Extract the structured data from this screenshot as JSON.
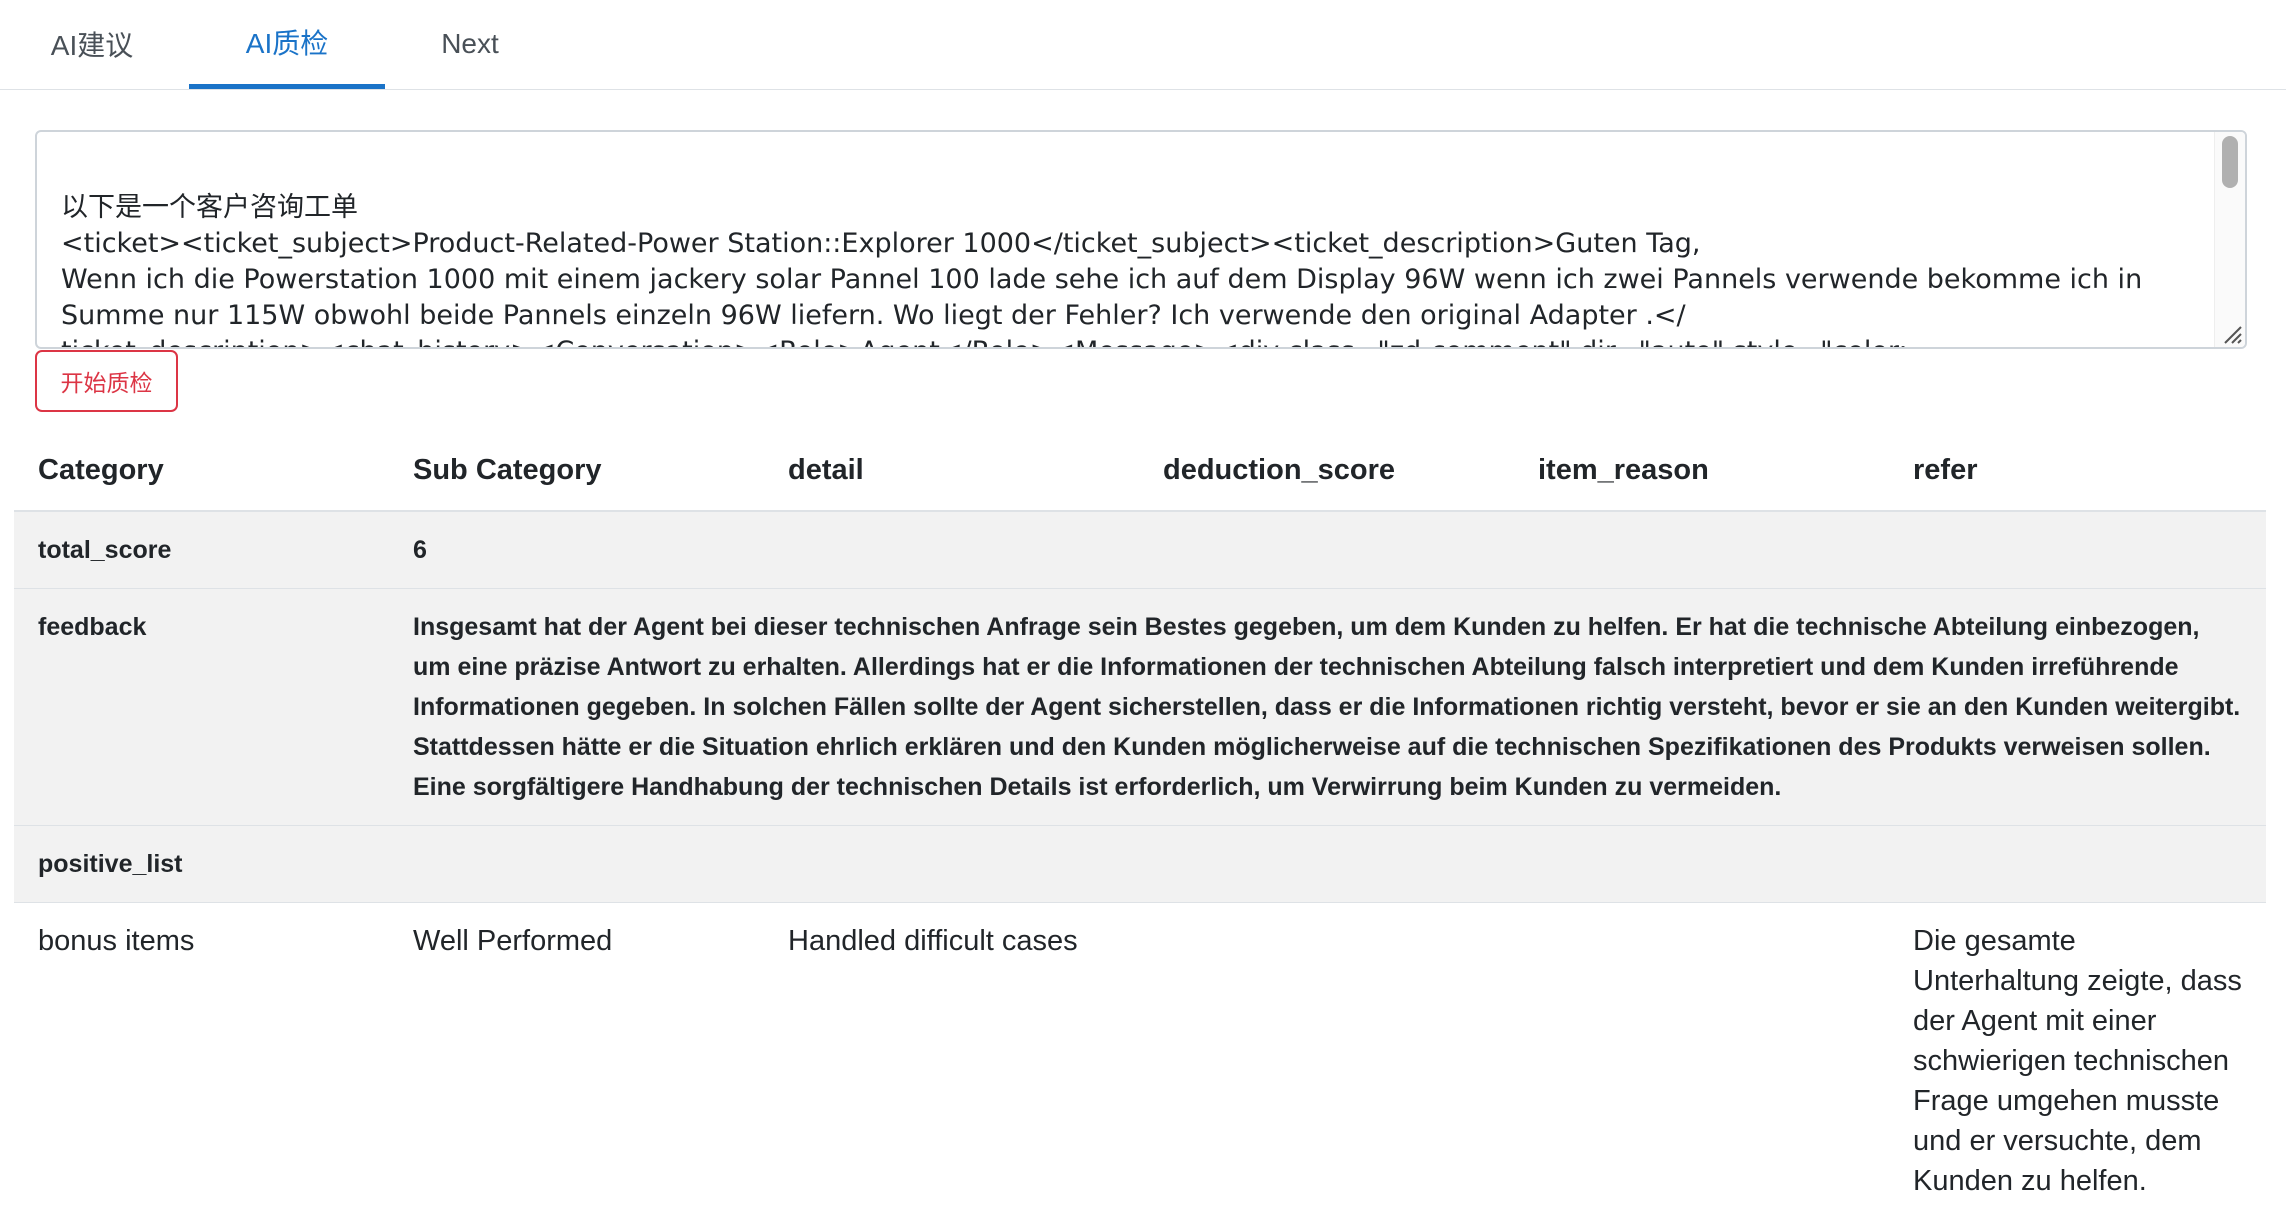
{
  "tabs": [
    {
      "label": "AI建议",
      "active": false
    },
    {
      "label": "AI质检",
      "active": true
    },
    {
      "label": "Next",
      "active": false
    }
  ],
  "prompt": {
    "value": "以下是一个客户咨询工单\n<ticket><ticket_subject>Product-Related-Power Station::Explorer 1000</ticket_subject><ticket_description>Guten Tag,\nWenn ich die Powerstation 1000 mit einem jackery solar Pannel 100 lade sehe ich auf dem Display 96W wenn ich zwei Pannels verwende bekomme ich in Summe nur 115W obwohl beide Pannels einzeln 96W liefern. Wo liegt der Fehler? Ich verwende den original Adapter .</\nticket_description><chat_history><Conversation><Role>Agent</Role><Message><div class=\"zd-comment\" dir=\"auto\" style=\"color:"
  },
  "start_button": {
    "label": "开始质检"
  },
  "table": {
    "headers": [
      "Category",
      "Sub Category",
      "detail",
      "deduction_score",
      "item_reason",
      "refer"
    ],
    "total_score": {
      "label": "total_score",
      "value": "6"
    },
    "feedback": {
      "label": "feedback",
      "text": "Insgesamt hat der Agent bei dieser technischen Anfrage sein Bestes gegeben, um dem Kunden zu helfen. Er hat die technische Abteilung einbezogen, um eine präzise Antwort zu erhalten. Allerdings hat er die Informationen der technischen Abteilung falsch interpretiert und dem Kunden irreführende Informationen gegeben. In solchen Fällen sollte der Agent sicherstellen, dass er die Informationen richtig versteht, bevor er sie an den Kunden weitergibt. Stattdessen hätte er die Situation ehrlich erklären und den Kunden möglicherweise auf die technischen Spezifikationen des Produkts verweisen sollen. Eine sorgfältigere Handhabung der technischen Details ist erforderlich, um Verwirrung beim Kunden zu vermeiden."
    },
    "positive_list": {
      "label": "positive_list"
    },
    "bonus_row": {
      "category": "bonus items",
      "sub_category": "Well Performed",
      "detail": "Handled difficult cases",
      "deduction_score": "",
      "item_reason": "",
      "refer": "Die gesamte Unterhaltung zeigte, dass der Agent mit einer schwierigen technischen Frage umgehen musste und er versuchte, dem Kunden zu helfen."
    }
  }
}
